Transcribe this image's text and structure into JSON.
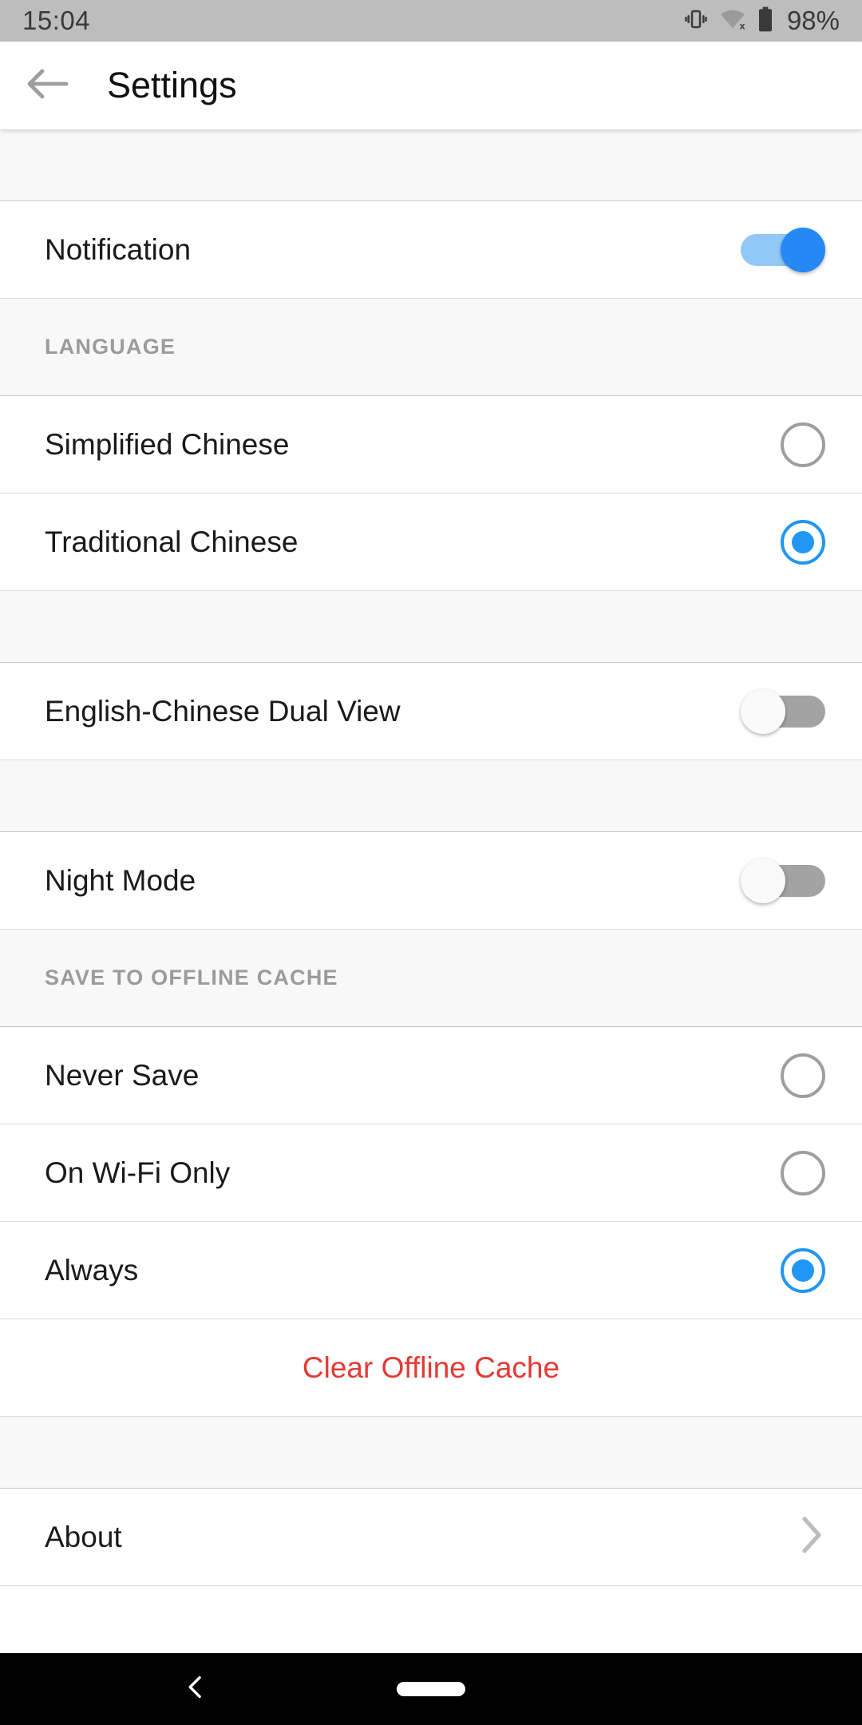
{
  "status_bar": {
    "time": "15:04",
    "battery_text": "98%",
    "icons": [
      "vibrate-icon",
      "wifi-off-icon",
      "battery-icon"
    ]
  },
  "app_bar": {
    "back_icon": "back-arrow-icon",
    "title": "Settings"
  },
  "colors": {
    "accent_blue": "#2196f3",
    "switch_on_track": "#92c8f7",
    "switch_on_thumb": "#2589f5",
    "switch_off_track": "#a3a3a3",
    "danger_red": "#e53935",
    "section_bg": "#f8f8f8",
    "status_bar_bg": "#bdbdbd"
  },
  "sections": [
    {
      "type": "spacer"
    },
    {
      "type": "rows",
      "rows": [
        {
          "label": "Notification",
          "control": "switch",
          "state": "on"
        }
      ]
    },
    {
      "type": "header",
      "label": "LANGUAGE"
    },
    {
      "type": "rows",
      "rows": [
        {
          "label": "Simplified Chinese",
          "control": "radio",
          "state": "off"
        },
        {
          "label": "Traditional Chinese",
          "control": "radio",
          "state": "on"
        }
      ]
    },
    {
      "type": "spacer"
    },
    {
      "type": "rows",
      "rows": [
        {
          "label": "English-Chinese Dual View",
          "control": "switch",
          "state": "off"
        }
      ]
    },
    {
      "type": "spacer"
    },
    {
      "type": "rows",
      "rows": [
        {
          "label": "Night Mode",
          "control": "switch",
          "state": "off"
        }
      ]
    },
    {
      "type": "header",
      "label": "SAVE TO OFFLINE CACHE"
    },
    {
      "type": "rows",
      "rows": [
        {
          "label": "Never Save",
          "control": "radio",
          "state": "off"
        },
        {
          "label": "On Wi-Fi Only",
          "control": "radio",
          "state": "off"
        },
        {
          "label": "Always",
          "control": "radio",
          "state": "on"
        }
      ]
    },
    {
      "type": "action",
      "label": "Clear Offline Cache"
    },
    {
      "type": "spacer"
    },
    {
      "type": "rows",
      "rows": [
        {
          "label": "About",
          "control": "chevron",
          "state": ""
        }
      ]
    }
  ],
  "nav_bar": {
    "back_icon": "nav-back-icon",
    "home_icon": "nav-home-pill-icon"
  }
}
